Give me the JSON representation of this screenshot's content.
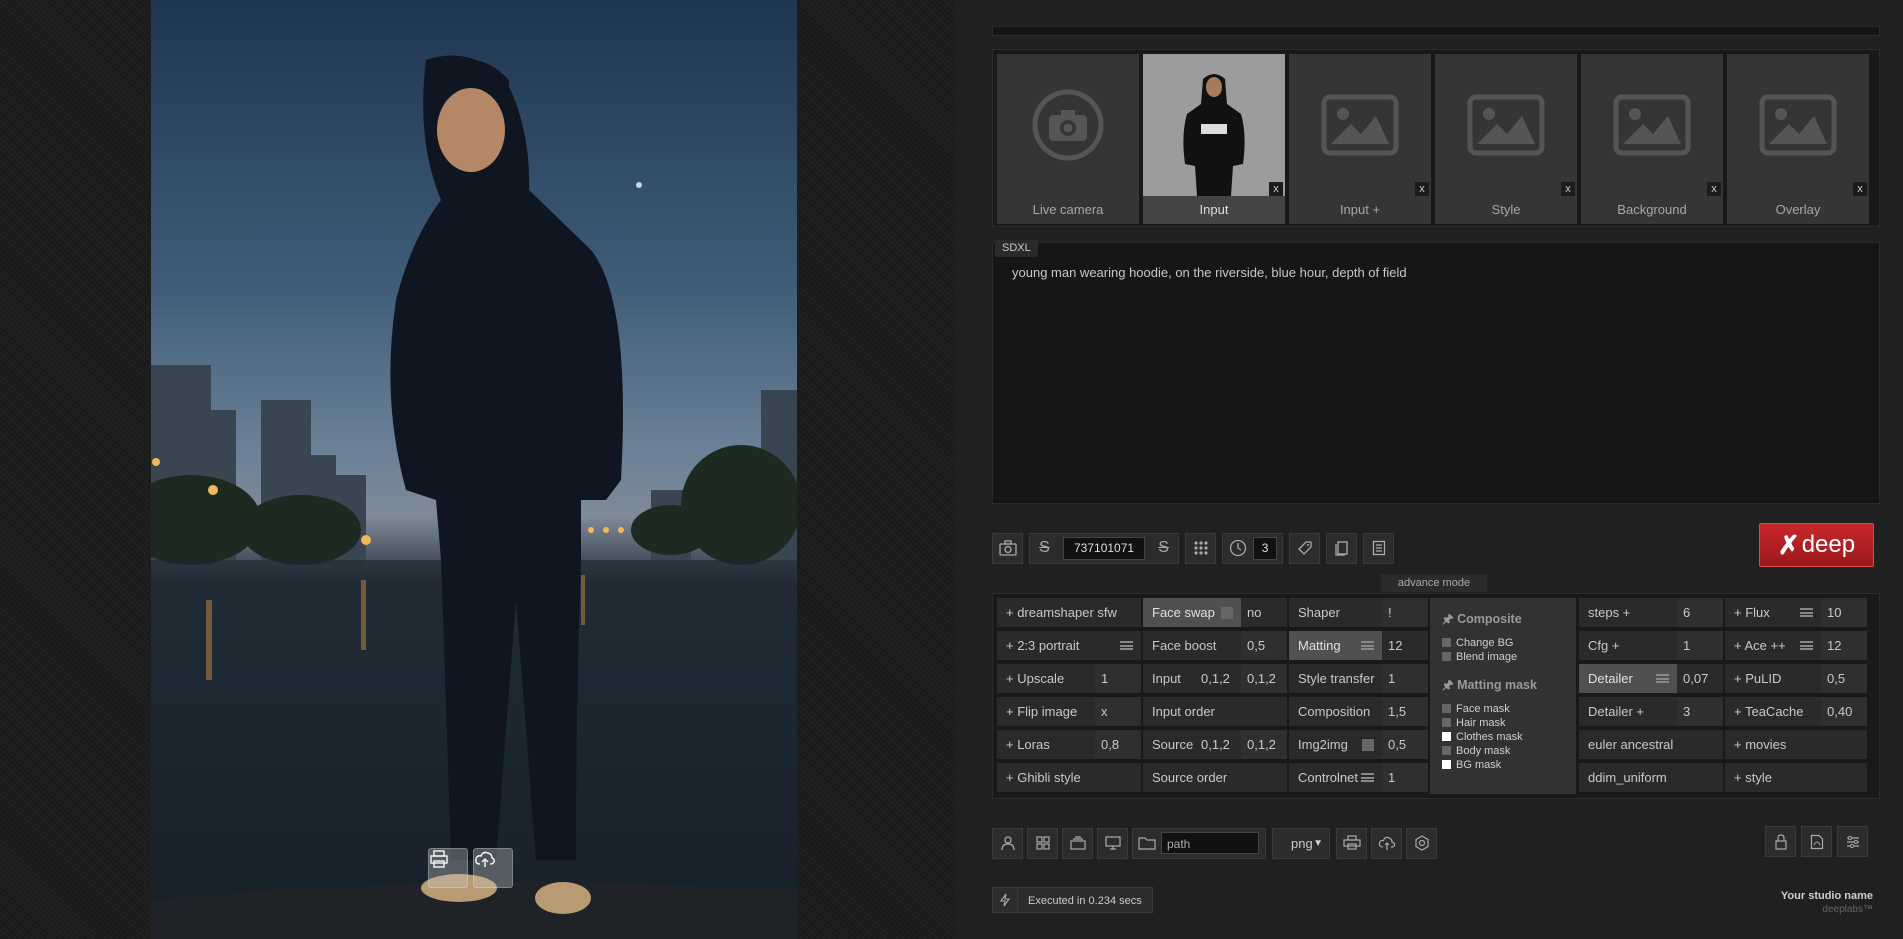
{
  "preview": {
    "print_icon": "print-icon",
    "cloud_icon": "cloud-upload-icon"
  },
  "thumbs": [
    {
      "label": "Live camera",
      "icon": "camera-icon",
      "close": ""
    },
    {
      "label": "Input",
      "icon": "photo",
      "close": "x"
    },
    {
      "label": "Input +",
      "icon": "image-placeholder-icon",
      "close": "x"
    },
    {
      "label": "Style",
      "icon": "image-placeholder-icon",
      "close": "x"
    },
    {
      "label": "Background",
      "icon": "image-placeholder-icon",
      "close": "x"
    },
    {
      "label": "Overlay",
      "icon": "image-placeholder-icon",
      "close": "x"
    }
  ],
  "prompt": {
    "model": "SDXL",
    "text": "young man wearing hoodie, on the riverside, blue hour, depth of field"
  },
  "toolbar": {
    "seed": "737101071",
    "steps": "3",
    "deep_label": "deep"
  },
  "advance_mode_label": "advance mode",
  "grid": {
    "col1": [
      {
        "label": "+ dreamshaper sfw",
        "value": ""
      },
      {
        "label": "+ 2:3 portrait",
        "value": ""
      },
      {
        "label": "+ Upscale",
        "value": "1"
      },
      {
        "label": "+ Flip image",
        "value": "x"
      },
      {
        "label": "+ Loras",
        "value": "0,8"
      },
      {
        "label": "+ Ghibli style",
        "value": ""
      }
    ],
    "col2": [
      {
        "label": "Face swap",
        "value": "no"
      },
      {
        "label": "Face boost",
        "value": "0,5"
      },
      {
        "label": "Input",
        "mid": "0,1,2",
        "value": "0,1,2"
      },
      {
        "label": "Input order",
        "value": ""
      },
      {
        "label": "Source",
        "mid": "0,1,2",
        "value": "0,1,2"
      },
      {
        "label": "Source order",
        "value": ""
      }
    ],
    "col3": [
      {
        "label": "Shaper",
        "value": "!"
      },
      {
        "label": "Matting",
        "value": "12"
      },
      {
        "label": "Style transfer",
        "value": "1"
      },
      {
        "label": "Composition",
        "value": "1,5"
      },
      {
        "label": "Img2img",
        "value": "0,5"
      },
      {
        "label": "Controlnet",
        "value": "1"
      }
    ],
    "composite": {
      "title": "Composite",
      "options": [
        "Change BG",
        "Blend image"
      ],
      "mask_title": "Matting mask",
      "mask_options": [
        {
          "label": "Face mask",
          "on": false
        },
        {
          "label": "Hair mask",
          "on": false
        },
        {
          "label": "Clothes mask",
          "on": true
        },
        {
          "label": "Body mask",
          "on": false
        },
        {
          "label": "BG mask",
          "on": true
        }
      ]
    },
    "col5": [
      {
        "label": "steps +",
        "value": "6"
      },
      {
        "label": "Cfg +",
        "value": "1"
      },
      {
        "label": "Detailer",
        "value": "0,07"
      },
      {
        "label": "Detailer +",
        "value": "3"
      },
      {
        "label": "euler ancestral",
        "value": ""
      },
      {
        "label": "ddim_uniform",
        "value": ""
      }
    ],
    "col6": [
      {
        "label": "+ Flux",
        "value": "10"
      },
      {
        "label": "+ Ace ++",
        "value": "12"
      },
      {
        "label": "+ PuLID",
        "value": "0,5"
      },
      {
        "label": "+ TeaCache",
        "value": "0,40"
      },
      {
        "label": "+ movies",
        "value": ""
      },
      {
        "label": "+ style",
        "value": ""
      }
    ]
  },
  "bottom": {
    "path_placeholder": "path",
    "format": "png"
  },
  "status": {
    "text": "Executed in 0.234 secs"
  },
  "studio": {
    "name": "Your studio name",
    "brand": "deeplabs™"
  }
}
